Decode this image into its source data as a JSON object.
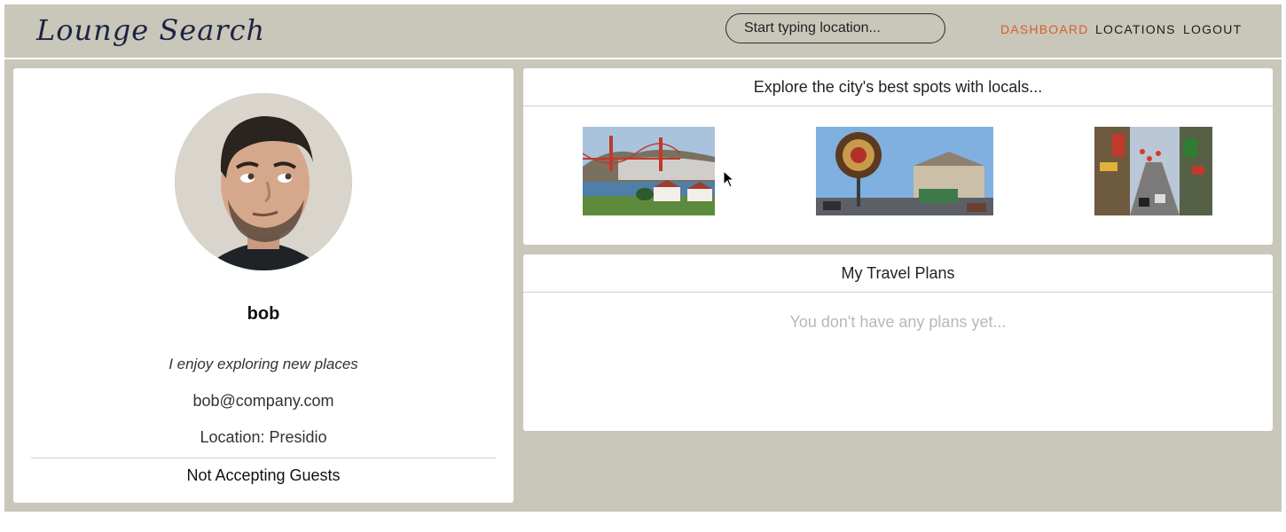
{
  "app": {
    "brand": "Lounge Search"
  },
  "search": {
    "placeholder": "Start typing location..."
  },
  "nav": {
    "items": [
      {
        "label": "DASHBOARD",
        "active": true
      },
      {
        "label": "LOCATIONS",
        "active": false
      },
      {
        "label": "LOGOUT",
        "active": false
      }
    ]
  },
  "profile": {
    "name": "bob",
    "bio": "I enjoy exploring new places",
    "email": "bob@company.com",
    "location": "Location: Presidio",
    "status": "Not Accepting Guests"
  },
  "explore": {
    "title": "Explore the city's best spots with locals...",
    "spots": [
      {
        "icon": "golden-gate-bridge-photo"
      },
      {
        "icon": "fishermans-wharf-photo"
      },
      {
        "icon": "chinatown-street-photo"
      }
    ]
  },
  "plans": {
    "title": "My Travel Plans",
    "empty": "You don't have any plans yet..."
  },
  "colors": {
    "background": "#c9c7ba",
    "card": "#ffffff",
    "active_link": "#d45f2a",
    "brand_text": "#1e2344"
  }
}
